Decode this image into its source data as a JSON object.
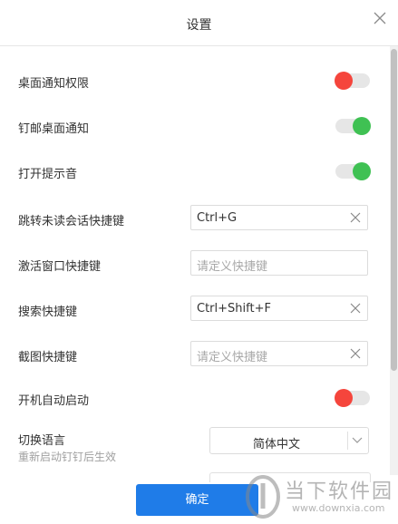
{
  "dialog": {
    "title": "设置",
    "confirm_label": "确定"
  },
  "settings": {
    "desktop_notify_permission": {
      "label": "桌面通知权限",
      "enabled": false
    },
    "pin_mail_desktop_notify": {
      "label": "钉邮桌面通知",
      "enabled": true
    },
    "play_sound": {
      "label": "打开提示音",
      "enabled": true
    },
    "jump_unread_shortcut": {
      "label": "跳转未读会话快捷键",
      "value": "Ctrl+G",
      "placeholder": ""
    },
    "activate_window_shortcut": {
      "label": "激活窗口快捷键",
      "value": "",
      "placeholder": "请定义快捷键"
    },
    "search_shortcut": {
      "label": "搜索快捷键",
      "value": "Ctrl+Shift+F",
      "placeholder": ""
    },
    "screenshot_shortcut": {
      "label": "截图快捷键",
      "value": "",
      "placeholder": "请定义快捷键"
    },
    "auto_start": {
      "label": "开机自动启动",
      "enabled": false
    },
    "language": {
      "label": "切换语言",
      "sublabel": "重新启动钉钉后生效",
      "selected": "简体中文"
    }
  },
  "watermark": {
    "main": "当下软件园",
    "sub": "www.downxia.com"
  },
  "colors": {
    "toggle_on": "#3fc153",
    "toggle_off": "#f5453c",
    "primary": "#1f7ce8"
  }
}
